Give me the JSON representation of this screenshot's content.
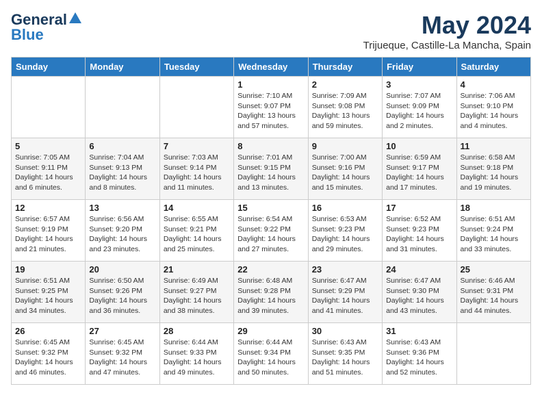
{
  "header": {
    "logo_line1": "General",
    "logo_line2": "Blue",
    "month": "May 2024",
    "location": "Trijueque, Castille-La Mancha, Spain"
  },
  "weekdays": [
    "Sunday",
    "Monday",
    "Tuesday",
    "Wednesday",
    "Thursday",
    "Friday",
    "Saturday"
  ],
  "weeks": [
    [
      {
        "day": "",
        "sunrise": "",
        "sunset": "",
        "daylight": ""
      },
      {
        "day": "",
        "sunrise": "",
        "sunset": "",
        "daylight": ""
      },
      {
        "day": "",
        "sunrise": "",
        "sunset": "",
        "daylight": ""
      },
      {
        "day": "1",
        "sunrise": "Sunrise: 7:10 AM",
        "sunset": "Sunset: 9:07 PM",
        "daylight": "Daylight: 13 hours and 57 minutes."
      },
      {
        "day": "2",
        "sunrise": "Sunrise: 7:09 AM",
        "sunset": "Sunset: 9:08 PM",
        "daylight": "Daylight: 13 hours and 59 minutes."
      },
      {
        "day": "3",
        "sunrise": "Sunrise: 7:07 AM",
        "sunset": "Sunset: 9:09 PM",
        "daylight": "Daylight: 14 hours and 2 minutes."
      },
      {
        "day": "4",
        "sunrise": "Sunrise: 7:06 AM",
        "sunset": "Sunset: 9:10 PM",
        "daylight": "Daylight: 14 hours and 4 minutes."
      }
    ],
    [
      {
        "day": "5",
        "sunrise": "Sunrise: 7:05 AM",
        "sunset": "Sunset: 9:11 PM",
        "daylight": "Daylight: 14 hours and 6 minutes."
      },
      {
        "day": "6",
        "sunrise": "Sunrise: 7:04 AM",
        "sunset": "Sunset: 9:13 PM",
        "daylight": "Daylight: 14 hours and 8 minutes."
      },
      {
        "day": "7",
        "sunrise": "Sunrise: 7:03 AM",
        "sunset": "Sunset: 9:14 PM",
        "daylight": "Daylight: 14 hours and 11 minutes."
      },
      {
        "day": "8",
        "sunrise": "Sunrise: 7:01 AM",
        "sunset": "Sunset: 9:15 PM",
        "daylight": "Daylight: 14 hours and 13 minutes."
      },
      {
        "day": "9",
        "sunrise": "Sunrise: 7:00 AM",
        "sunset": "Sunset: 9:16 PM",
        "daylight": "Daylight: 14 hours and 15 minutes."
      },
      {
        "day": "10",
        "sunrise": "Sunrise: 6:59 AM",
        "sunset": "Sunset: 9:17 PM",
        "daylight": "Daylight: 14 hours and 17 minutes."
      },
      {
        "day": "11",
        "sunrise": "Sunrise: 6:58 AM",
        "sunset": "Sunset: 9:18 PM",
        "daylight": "Daylight: 14 hours and 19 minutes."
      }
    ],
    [
      {
        "day": "12",
        "sunrise": "Sunrise: 6:57 AM",
        "sunset": "Sunset: 9:19 PM",
        "daylight": "Daylight: 14 hours and 21 minutes."
      },
      {
        "day": "13",
        "sunrise": "Sunrise: 6:56 AM",
        "sunset": "Sunset: 9:20 PM",
        "daylight": "Daylight: 14 hours and 23 minutes."
      },
      {
        "day": "14",
        "sunrise": "Sunrise: 6:55 AM",
        "sunset": "Sunset: 9:21 PM",
        "daylight": "Daylight: 14 hours and 25 minutes."
      },
      {
        "day": "15",
        "sunrise": "Sunrise: 6:54 AM",
        "sunset": "Sunset: 9:22 PM",
        "daylight": "Daylight: 14 hours and 27 minutes."
      },
      {
        "day": "16",
        "sunrise": "Sunrise: 6:53 AM",
        "sunset": "Sunset: 9:23 PM",
        "daylight": "Daylight: 14 hours and 29 minutes."
      },
      {
        "day": "17",
        "sunrise": "Sunrise: 6:52 AM",
        "sunset": "Sunset: 9:23 PM",
        "daylight": "Daylight: 14 hours and 31 minutes."
      },
      {
        "day": "18",
        "sunrise": "Sunrise: 6:51 AM",
        "sunset": "Sunset: 9:24 PM",
        "daylight": "Daylight: 14 hours and 33 minutes."
      }
    ],
    [
      {
        "day": "19",
        "sunrise": "Sunrise: 6:51 AM",
        "sunset": "Sunset: 9:25 PM",
        "daylight": "Daylight: 14 hours and 34 minutes."
      },
      {
        "day": "20",
        "sunrise": "Sunrise: 6:50 AM",
        "sunset": "Sunset: 9:26 PM",
        "daylight": "Daylight: 14 hours and 36 minutes."
      },
      {
        "day": "21",
        "sunrise": "Sunrise: 6:49 AM",
        "sunset": "Sunset: 9:27 PM",
        "daylight": "Daylight: 14 hours and 38 minutes."
      },
      {
        "day": "22",
        "sunrise": "Sunrise: 6:48 AM",
        "sunset": "Sunset: 9:28 PM",
        "daylight": "Daylight: 14 hours and 39 minutes."
      },
      {
        "day": "23",
        "sunrise": "Sunrise: 6:47 AM",
        "sunset": "Sunset: 9:29 PM",
        "daylight": "Daylight: 14 hours and 41 minutes."
      },
      {
        "day": "24",
        "sunrise": "Sunrise: 6:47 AM",
        "sunset": "Sunset: 9:30 PM",
        "daylight": "Daylight: 14 hours and 43 minutes."
      },
      {
        "day": "25",
        "sunrise": "Sunrise: 6:46 AM",
        "sunset": "Sunset: 9:31 PM",
        "daylight": "Daylight: 14 hours and 44 minutes."
      }
    ],
    [
      {
        "day": "26",
        "sunrise": "Sunrise: 6:45 AM",
        "sunset": "Sunset: 9:32 PM",
        "daylight": "Daylight: 14 hours and 46 minutes."
      },
      {
        "day": "27",
        "sunrise": "Sunrise: 6:45 AM",
        "sunset": "Sunset: 9:32 PM",
        "daylight": "Daylight: 14 hours and 47 minutes."
      },
      {
        "day": "28",
        "sunrise": "Sunrise: 6:44 AM",
        "sunset": "Sunset: 9:33 PM",
        "daylight": "Daylight: 14 hours and 49 minutes."
      },
      {
        "day": "29",
        "sunrise": "Sunrise: 6:44 AM",
        "sunset": "Sunset: 9:34 PM",
        "daylight": "Daylight: 14 hours and 50 minutes."
      },
      {
        "day": "30",
        "sunrise": "Sunrise: 6:43 AM",
        "sunset": "Sunset: 9:35 PM",
        "daylight": "Daylight: 14 hours and 51 minutes."
      },
      {
        "day": "31",
        "sunrise": "Sunrise: 6:43 AM",
        "sunset": "Sunset: 9:36 PM",
        "daylight": "Daylight: 14 hours and 52 minutes."
      },
      {
        "day": "",
        "sunrise": "",
        "sunset": "",
        "daylight": ""
      }
    ]
  ]
}
